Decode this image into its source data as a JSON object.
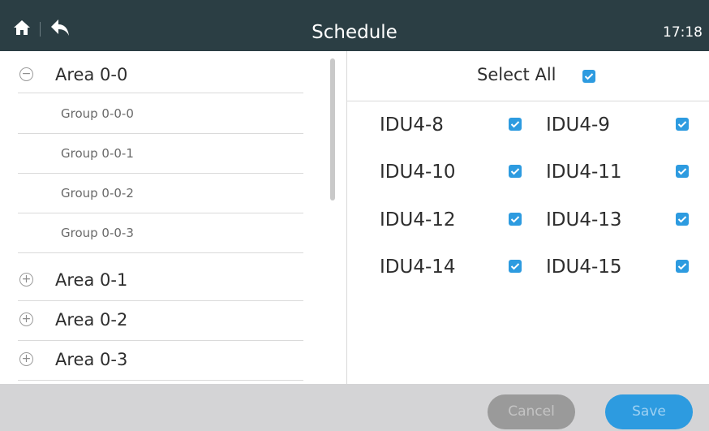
{
  "header": {
    "title": "Schedule",
    "time": "17:18",
    "home_icon": "home-icon",
    "back_icon": "back-arrow-icon"
  },
  "tree": {
    "areas": [
      {
        "label": "Area 0-0",
        "expanded": true,
        "icon": "collapse-minus-icon"
      },
      {
        "label": "Area 0-1",
        "expanded": false,
        "icon": "expand-plus-icon"
      },
      {
        "label": "Area 0-2",
        "expanded": false,
        "icon": "expand-plus-icon"
      },
      {
        "label": "Area 0-3",
        "expanded": false,
        "icon": "expand-plus-icon"
      }
    ],
    "groups": [
      {
        "label": "Group 0-0-0"
      },
      {
        "label": "Group 0-0-1"
      },
      {
        "label": "Group 0-0-2"
      },
      {
        "label": "Group 0-0-3"
      }
    ],
    "collapse_symbol": "−",
    "expand_symbol": "+"
  },
  "devices": {
    "select_all_label": "Select All",
    "select_all_checked": true,
    "items": [
      {
        "label": "IDU4-8",
        "checked": true
      },
      {
        "label": "IDU4-9",
        "checked": true
      },
      {
        "label": "IDU4-10",
        "checked": true
      },
      {
        "label": "IDU4-11",
        "checked": true
      },
      {
        "label": "IDU4-12",
        "checked": true
      },
      {
        "label": "IDU4-13",
        "checked": true
      },
      {
        "label": "IDU4-14",
        "checked": true
      },
      {
        "label": "IDU4-15",
        "checked": true
      }
    ]
  },
  "footer": {
    "cancel_label": "Cancel",
    "save_label": "Save"
  },
  "colors": {
    "header_bg": "#2b3e44",
    "accent": "#2d9be0",
    "footer_bg": "#d4d4d6"
  }
}
